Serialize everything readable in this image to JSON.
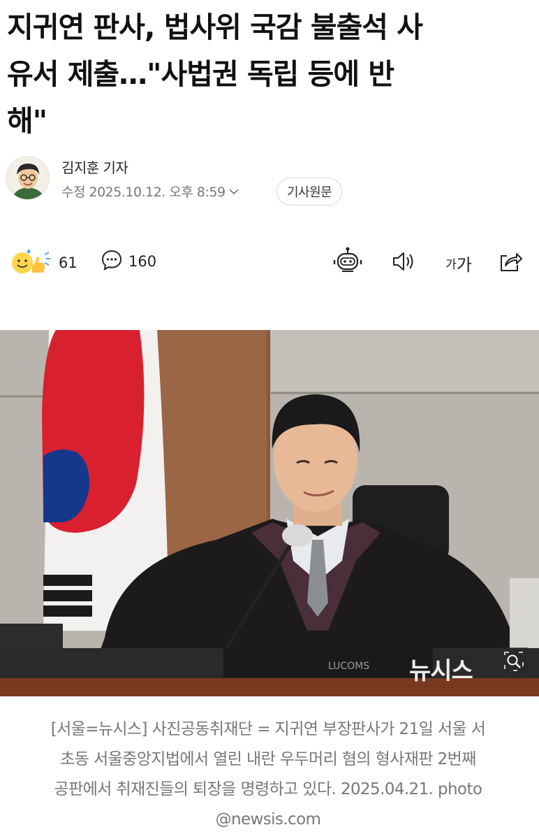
{
  "article": {
    "headline_lines": [
      "지귀연 판사, 법사위 국감 불출석 사",
      "유서 제출…\"사법권 독립 등에 반",
      "해\""
    ]
  },
  "byline": {
    "author": "김지훈 기자",
    "modified": "수정 2025.10.12. 오후 8:59",
    "source_button": "기사원문"
  },
  "actions": {
    "reaction_count": "61",
    "comment_count": "160",
    "font_size_label_small": "가",
    "font_size_label_big": "가"
  },
  "icons": {
    "reaction": "smile-thumbs-icon",
    "comment": "speech-bubble-icon",
    "summary_bot": "robot-icon",
    "tts": "speaker-icon",
    "share": "share-icon",
    "zoom": "magnifier-icon"
  },
  "photo": {
    "watermark": "뉴시스",
    "podium_text": "LUCOMS"
  },
  "caption": {
    "lines": [
      "[서울=뉴시스] 사진공동취재단 = 지귀연 부장판사가 21일 서울 서",
      "초동 서울중앙지법에서 열린 내란 우두머리 혐의 형사재판 2번째",
      "공판에서 취재진들의 퇴장을 명령하고 있다. 2025.04.21. photo",
      "@newsis.com"
    ]
  },
  "colors": {
    "text": "#111111",
    "muted": "#777777",
    "border": "#d8d8d8"
  }
}
